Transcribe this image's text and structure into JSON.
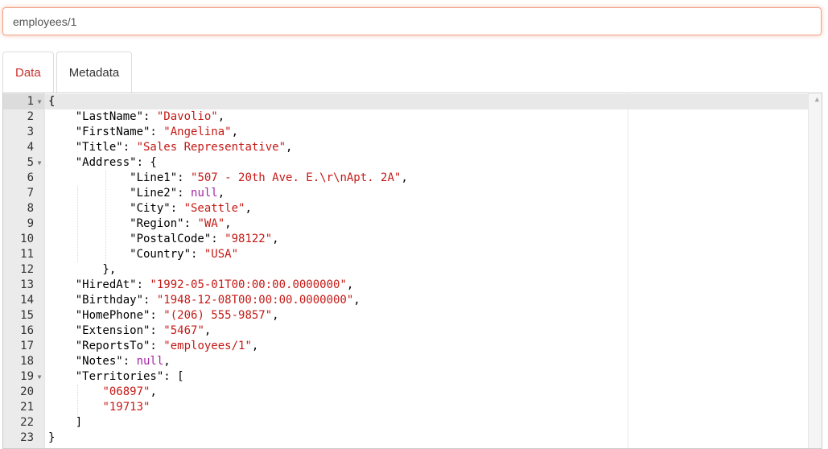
{
  "document_input": {
    "value": "employees/1"
  },
  "tabs": [
    {
      "label": "Data",
      "active": true
    },
    {
      "label": "Metadata",
      "active": false
    }
  ],
  "editor": {
    "lines": [
      {
        "num": "1",
        "fold": true,
        "code": [
          [
            "p",
            "{"
          ]
        ]
      },
      {
        "num": "2",
        "code": [
          [
            "p",
            "    \"LastName\": "
          ],
          [
            "s",
            "\"Davolio\""
          ],
          [
            "p",
            ","
          ]
        ]
      },
      {
        "num": "3",
        "code": [
          [
            "p",
            "    \"FirstName\": "
          ],
          [
            "s",
            "\"Angelina\""
          ],
          [
            "p",
            ","
          ]
        ]
      },
      {
        "num": "4",
        "code": [
          [
            "p",
            "    \"Title\": "
          ],
          [
            "s",
            "\"Sales Representative\""
          ],
          [
            "p",
            ","
          ]
        ]
      },
      {
        "num": "5",
        "fold": true,
        "code": [
          [
            "p",
            "    \"Address\": {"
          ]
        ]
      },
      {
        "num": "6",
        "code": [
          [
            "p",
            "            \"Line1\": "
          ],
          [
            "s",
            "\"507 - 20th Ave. E.\\r\\nApt. 2A\""
          ],
          [
            "p",
            ","
          ]
        ]
      },
      {
        "num": "7",
        "code": [
          [
            "p",
            "            \"Line2\": "
          ],
          [
            "n",
            "null"
          ],
          [
            "p",
            ","
          ]
        ]
      },
      {
        "num": "8",
        "code": [
          [
            "p",
            "            \"City\": "
          ],
          [
            "s",
            "\"Seattle\""
          ],
          [
            "p",
            ","
          ]
        ]
      },
      {
        "num": "9",
        "code": [
          [
            "p",
            "            \"Region\": "
          ],
          [
            "s",
            "\"WA\""
          ],
          [
            "p",
            ","
          ]
        ]
      },
      {
        "num": "10",
        "code": [
          [
            "p",
            "            \"PostalCode\": "
          ],
          [
            "s",
            "\"98122\""
          ],
          [
            "p",
            ","
          ]
        ]
      },
      {
        "num": "11",
        "code": [
          [
            "p",
            "            \"Country\": "
          ],
          [
            "s",
            "\"USA\""
          ]
        ]
      },
      {
        "num": "12",
        "code": [
          [
            "p",
            "        },"
          ]
        ]
      },
      {
        "num": "13",
        "code": [
          [
            "p",
            "    \"HiredAt\": "
          ],
          [
            "s",
            "\"1992-05-01T00:00:00.0000000\""
          ],
          [
            "p",
            ","
          ]
        ]
      },
      {
        "num": "14",
        "code": [
          [
            "p",
            "    \"Birthday\": "
          ],
          [
            "s",
            "\"1948-12-08T00:00:00.0000000\""
          ],
          [
            "p",
            ","
          ]
        ]
      },
      {
        "num": "15",
        "code": [
          [
            "p",
            "    \"HomePhone\": "
          ],
          [
            "s",
            "\"(206) 555-9857\""
          ],
          [
            "p",
            ","
          ]
        ]
      },
      {
        "num": "16",
        "code": [
          [
            "p",
            "    \"Extension\": "
          ],
          [
            "s",
            "\"5467\""
          ],
          [
            "p",
            ","
          ]
        ]
      },
      {
        "num": "17",
        "code": [
          [
            "p",
            "    \"ReportsTo\": "
          ],
          [
            "s",
            "\"employees/1\""
          ],
          [
            "p",
            ","
          ]
        ]
      },
      {
        "num": "18",
        "code": [
          [
            "p",
            "    \"Notes\": "
          ],
          [
            "n",
            "null"
          ],
          [
            "p",
            ","
          ]
        ]
      },
      {
        "num": "19",
        "fold": true,
        "code": [
          [
            "p",
            "    \"Territories\": ["
          ]
        ]
      },
      {
        "num": "20",
        "code": [
          [
            "p",
            "        "
          ],
          [
            "s",
            "\"06897\""
          ],
          [
            "p",
            ","
          ]
        ]
      },
      {
        "num": "21",
        "code": [
          [
            "p",
            "        "
          ],
          [
            "s",
            "\"19713\""
          ]
        ]
      },
      {
        "num": "22",
        "code": [
          [
            "p",
            "    ]"
          ]
        ]
      },
      {
        "num": "23",
        "code": [
          [
            "p",
            "}"
          ]
        ]
      }
    ]
  },
  "icons": {
    "fold": "fold-arrow-icon",
    "scroll_up": "scroll-up-arrow-icon"
  },
  "colors": {
    "string": "#c41a16",
    "null": "#a626a4",
    "active_tab": "#c9302c",
    "input_focus_border": "#f0a58a"
  }
}
